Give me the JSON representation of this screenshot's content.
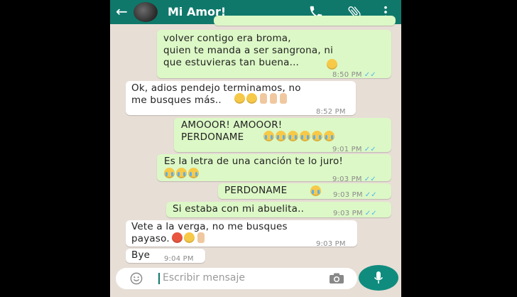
{
  "header": {
    "back_icon": "back-arrow-icon",
    "contact_name": "Mi Amor!",
    "color": "#0f786b",
    "actions": [
      "phone-icon",
      "attach-icon",
      "more-vert-icon"
    ]
  },
  "messages": [
    {
      "dir": "out",
      "text": "volver contigo era broma,\nquien te manda a ser sangrona, ni\nque estuvieras tan buena...",
      "time": "8:50 PM",
      "ticks": "✓✓"
    },
    {
      "dir": "in",
      "text": "Ok, adios pendejo terminamos, no\nme busques más..",
      "time": "8:52 PM"
    },
    {
      "dir": "out",
      "text": "AMOOOR! AMOOOR!\nPERDONAME",
      "time": "9:01 PM",
      "ticks": "✓✓"
    },
    {
      "dir": "out",
      "text": "Es la letra de una canción te lo juro!",
      "time": "9:03 PM",
      "ticks": "✓✓"
    },
    {
      "dir": "out",
      "text": "PERDONAME",
      "time": "9:03 PM",
      "ticks": "✓✓"
    },
    {
      "dir": "out",
      "text": "Si estaba con mi abuelita..",
      "time": "9:03 PM",
      "ticks": "✓✓"
    },
    {
      "dir": "in",
      "text": "Vete a la verga, no me busques\npayaso.",
      "time": "9:03 PM"
    },
    {
      "dir": "in",
      "text": "Bye",
      "time": "9:04 PM"
    }
  ],
  "input": {
    "placeholder": "Escribir mensaje",
    "emoji_icon": "emoji-icon",
    "camera_icon": "camera-icon",
    "mic_icon": "mic-icon"
  },
  "colors": {
    "outgoing_bubble": "#dcf8c6",
    "incoming_bubble": "#ffffff",
    "chat_background": "#e7ded6",
    "read_ticks": "#4fb6ec"
  }
}
